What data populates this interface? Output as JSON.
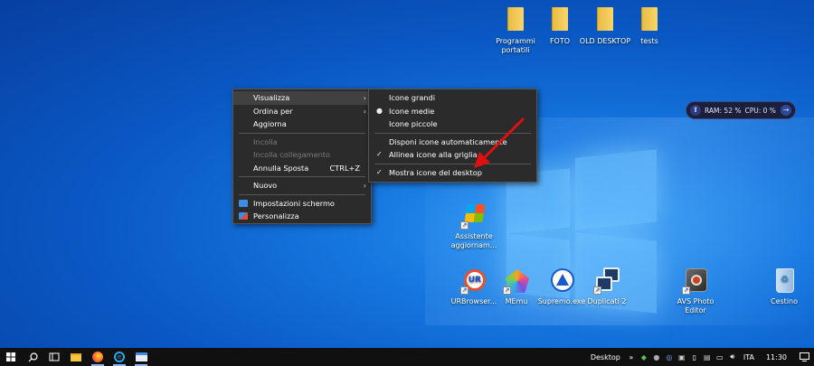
{
  "desktop": {
    "top_icons": [
      {
        "label": "Programmi portatili"
      },
      {
        "label": "FOTO"
      },
      {
        "label": "OLD DESKTOP"
      },
      {
        "label": "tests"
      }
    ],
    "assistant_icon": {
      "label": "Assistente aggiornam..."
    },
    "bottom_icons": [
      {
        "label": "URBrowser..."
      },
      {
        "label": "MEmu"
      },
      {
        "label": "Supremo.exe"
      },
      {
        "label": "Duplicati 2"
      },
      {
        "label": "AVS Photo Editor"
      },
      {
        "label": "Cestino"
      }
    ]
  },
  "widget": {
    "ram": "RAM: 52 %",
    "cpu": "CPU: 0 %"
  },
  "context_menu": {
    "items": [
      {
        "label": "Visualizza"
      },
      {
        "label": "Ordina per"
      },
      {
        "label": "Aggiorna"
      },
      {
        "label": "Incolla"
      },
      {
        "label": "Incolla collegamento"
      },
      {
        "label": "Annulla Sposta",
        "shortcut": "CTRL+Z"
      },
      {
        "label": "Nuovo"
      },
      {
        "label": "Impostazioni schermo"
      },
      {
        "label": "Personalizza"
      }
    ]
  },
  "view_submenu": {
    "items": [
      {
        "label": "Icone grandi"
      },
      {
        "label": "Icone medie"
      },
      {
        "label": "Icone piccole"
      },
      {
        "label": "Disponi icone automaticamente"
      },
      {
        "label": "Allinea icone alla griglia"
      },
      {
        "label": "Mostra icone del desktop"
      }
    ]
  },
  "taskbar": {
    "desktop_label": "Desktop",
    "language": "ITA",
    "time": "11:30"
  },
  "colors": {
    "accent": "#1677e0",
    "arrow": "#e01010",
    "menu_bg": "#2b2b2b"
  }
}
